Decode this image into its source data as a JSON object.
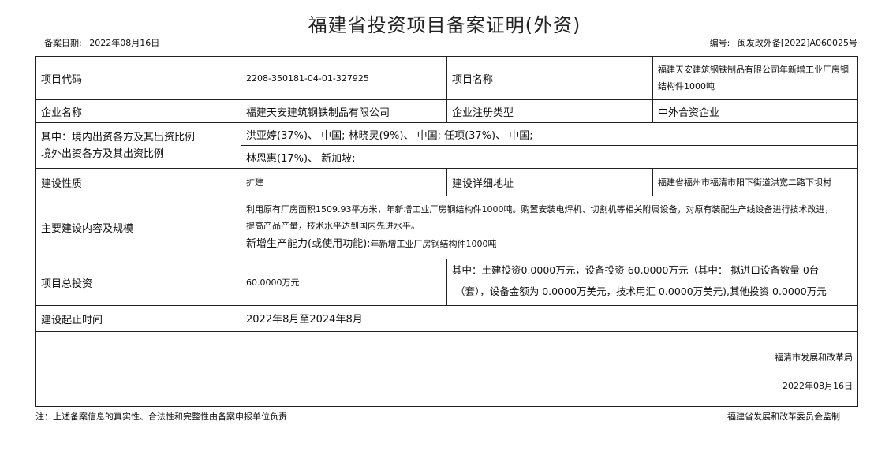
{
  "title": "福建省投资项目备案证明(外资)",
  "filing_date_label": "备案日期:",
  "filing_date": "2022年08月16日",
  "number_label": "编号:",
  "number": "闽发改外备[2022]A060025号",
  "rows": {
    "project_code_label": "项目代码",
    "project_code": "2208-350181-04-01-327925",
    "project_name_label": "项目名称",
    "project_name_line1": "福建天安建筑钢铁制品有限公司年新增工业厂房钢",
    "project_name_line2": "结构件1000吨",
    "company_label": "企业名称",
    "company": "福建天安建筑钢铁制品有限公司",
    "reg_type_label": "企业注册类型",
    "reg_type": "中外合资企业",
    "investors_label_line1": "其中：境内出资各方及其出资比例",
    "investors_label_line2": "境外出资各方及其出资比例",
    "domestic_investors": "洪亚婷(37%)、 中国; 林晓灵(9%)、 中国; 任项(37%)、 中国;",
    "foreign_investors": "林恩惠(17%)、 新加坡;",
    "nature_label": "建设性质",
    "nature": "扩建",
    "address_label": "建设详细地址",
    "address": "福建省福州市福清市阳下街道洪宽二路下坝村",
    "content_label": "主要建设内容及规模",
    "content_line1": "利用原有厂房面积1509.93平方米，年新增工业厂房钢结构件1000吨。购置安装电焊机、切割机等相关附属设备，对原有装配生产线设备进行技术改进，",
    "content_line2": "提高产品产量，技术水平达到国内先进水平。",
    "capacity_label": "新增生产能力(或使用功能):",
    "capacity": "年新增工业厂房钢结构件1000吨",
    "total_investment_label": "项目总投资",
    "total_investment": "60.0000万元",
    "investment_detail_line1": "其中：土建投资0.0000万元，设备投资 60.0000万元（其中： 拟进口设备数量 0台",
    "investment_detail_line2": "（套），设备金额为 0.0000万美元，技术用汇 0.0000万美元),其他投资 0.0000万元",
    "period_label": "建设起止时间",
    "period": "2022年8月至2024年8月"
  },
  "signature": {
    "org": "福清市发展和改革局",
    "date": "2022年08月16日"
  },
  "footer": {
    "note": "注：上述备案信息的真实性、合法性和完整性由备案申报单位负责",
    "supervisor": "福建省发展和改革委员会监制"
  }
}
